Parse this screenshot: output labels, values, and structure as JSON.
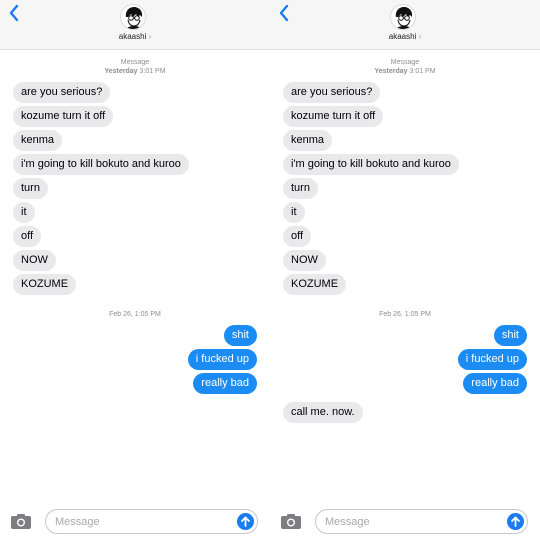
{
  "accent_color": "#1b8cf3",
  "contact": {
    "name": "akaashi",
    "chevron": "›"
  },
  "thread_meta": {
    "service": "Message",
    "day": "Yesterday",
    "time": "3:01 PM"
  },
  "incoming_block": [
    "are you serious?",
    "kozume turn it off",
    "kenma",
    "i'm going to kill bokuto and kuroo",
    "turn",
    "it",
    "off",
    "NOW",
    "KOZUME"
  ],
  "timestamp_2": "Feb 26, 1:05 PM",
  "outgoing_block": [
    "shit",
    "i fucked up",
    "really bad"
  ],
  "reply": "call me. now.",
  "composer": {
    "placeholder": "Message"
  },
  "icons": {
    "back": "chevron-left-icon",
    "camera": "camera-icon",
    "send": "arrow-up-icon"
  }
}
